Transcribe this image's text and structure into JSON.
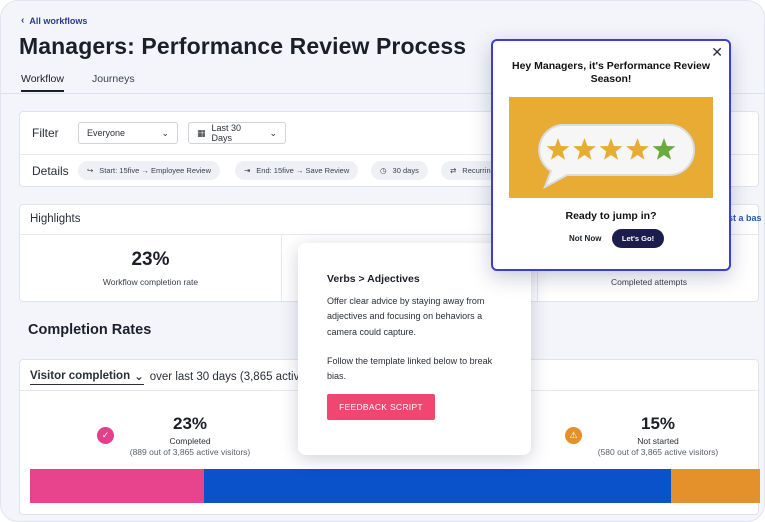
{
  "header": {
    "back_label": "All workflows",
    "title": "Managers: Performance Review Process",
    "tabs": [
      {
        "label": "Workflow",
        "active": true
      },
      {
        "label": "Journeys",
        "active": false
      }
    ]
  },
  "filter": {
    "label": "Filter",
    "audience_value": "Everyone",
    "date_value": "Last 30 Days",
    "details_label": "Details",
    "chips": [
      {
        "label": "Start: 15five → Employee Review",
        "icon": "start-icon"
      },
      {
        "label": "End: 15five → Save Review",
        "icon": "end-icon"
      },
      {
        "label": "30 days",
        "icon": "clock-icon"
      },
      {
        "label": "Recurring",
        "icon": "recurring-icon"
      }
    ]
  },
  "highlights": {
    "title": "Highlights",
    "items": [
      {
        "value": "23%",
        "label": "Workflow completion rate"
      },
      {
        "value": "",
        "label": "Completed attempts"
      }
    ],
    "link_partial": "st a bas"
  },
  "completion": {
    "section_title": "Completion Rates",
    "metric_selector": "Visitor completion",
    "range_text": "over last 30 days (3,865 active",
    "stats": [
      {
        "value": "23%",
        "label": "Completed",
        "sub": "(889 out of 3,865 active visitors)",
        "icon": "check-circle-icon"
      },
      {
        "value": "15%",
        "label": "Not started",
        "sub": "(580 out of 3,865 active visitors)",
        "icon": "warning-icon"
      }
    ],
    "bar_segments": [
      {
        "name": "completed",
        "fraction": 0.238,
        "color": "#e7448d"
      },
      {
        "name": "in-progress",
        "fraction": 0.64,
        "color": "#0a52c9"
      },
      {
        "name": "not-started",
        "fraction": 0.122,
        "color": "#e4902b"
      }
    ]
  },
  "tooltip": {
    "title": "Verbs > Adjectives",
    "body1": "Offer clear advice by staying away from adjectives and focusing on behaviors a camera could capture.",
    "body2": "Follow the template linked below to break bias.",
    "button_label": "FEEDBACK SCRIPT"
  },
  "modal": {
    "title": "Hey Managers, it's Performance Review Season!",
    "question": "Ready to jump in?",
    "secondary_label": "Not Now",
    "primary_label": "Let's Go!",
    "art": {
      "background": "#e8ac35",
      "stars": 5,
      "star_color_main": "#e8ac35",
      "star_color_last": "#6aab3c"
    }
  },
  "colors": {
    "accent": "#3d3fd0",
    "pink": "#f0466f",
    "navy": "#1b1d4d"
  }
}
